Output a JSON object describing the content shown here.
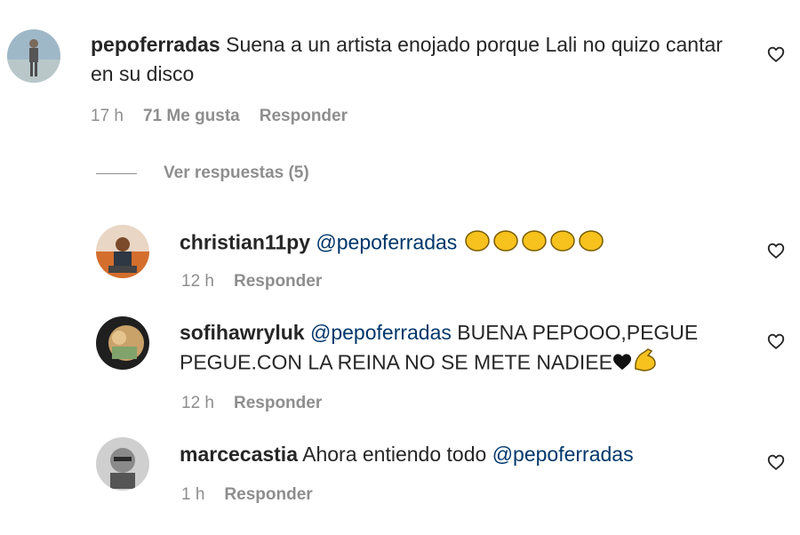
{
  "comments": [
    {
      "username": "pepoferradas",
      "text": "Suena a un artista enojado porque Lali no quizo cantar en su disco",
      "time": "17 h",
      "likes": "71 Me gusta",
      "reply": "Responder"
    }
  ],
  "view_replies": "Ver respuestas (5)",
  "replies": [
    {
      "username": "christian11py",
      "mention": "@pepoferradas",
      "text": "",
      "emoji": "clapping-hands x5",
      "time": "12 h",
      "reply": "Responder"
    },
    {
      "username": "sofihawryluk",
      "mention": "@pepoferradas",
      "text_line1": "BUENA PEPOOO,PEGUE",
      "text_line2": "PEGUE.CON LA REINA NO SE METE NADIEE",
      "emoji": "black-heart, flexed-biceps",
      "time": "12 h",
      "reply": "Responder"
    },
    {
      "username": "marcecastia",
      "text": "Ahora entiendo todo",
      "mention": "@pepoferradas",
      "time": "1 h",
      "reply": "Responder"
    }
  ],
  "colors": {
    "text": "#262626",
    "muted": "#8e8e8e",
    "mention": "#00376b",
    "emoji": "#f7c21e"
  },
  "icons": [
    "heart-outline-icon"
  ]
}
